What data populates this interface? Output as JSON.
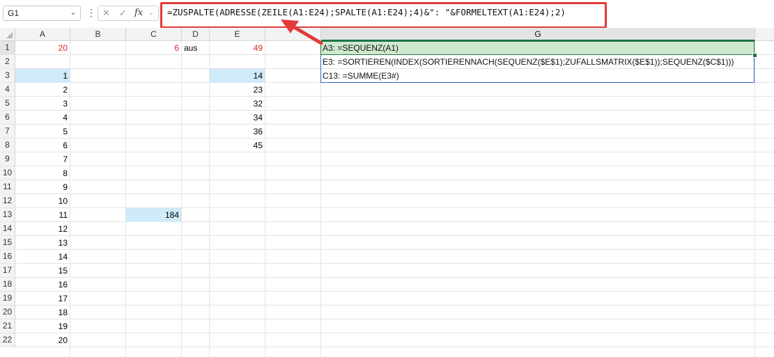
{
  "formula_bar": {
    "name_box": "G1",
    "formula": "=ZUSPALTE(ADRESSE(ZEILE(A1:E24);SPALTE(A1:E24);4)&\": \"&FORMELTEXT(A1:E24);2)",
    "fx_label": "fx"
  },
  "columns": [
    "A",
    "B",
    "C",
    "D",
    "E",
    "G"
  ],
  "rows": [
    "1",
    "2",
    "3",
    "4",
    "5",
    "6",
    "7",
    "8",
    "9",
    "10",
    "11",
    "12",
    "13",
    "14",
    "15",
    "16",
    "17",
    "18",
    "19",
    "20",
    "21",
    "22"
  ],
  "cells": {
    "A1": "20",
    "C1": "6",
    "D1": "aus",
    "E1": "49",
    "A3": "1",
    "A4": "2",
    "A5": "3",
    "A6": "4",
    "A7": "5",
    "A8": "6",
    "A9": "7",
    "A10": "8",
    "A11": "9",
    "A12": "10",
    "A13": "11",
    "A14": "12",
    "A15": "13",
    "A16": "14",
    "A17": "15",
    "A18": "16",
    "A19": "17",
    "A20": "18",
    "A21": "19",
    "A22": "20",
    "E3": "14",
    "E4": "23",
    "E5": "32",
    "E6": "34",
    "E7": "36",
    "E8": "45",
    "C13": "184",
    "G1": "A3: =SEQUENZ(A1)",
    "G2": "E3: =SORTIEREN(INDEX(SORTIERENNACH(SEQUENZ($E$1);ZUFALLSMATRIX($E$1));SEQUENZ($C$1)))",
    "G3": "C13: =SUMME(E3#)"
  },
  "colors": {
    "accent_green": "#217346",
    "highlight_blue": "#cfeaf8",
    "input_red": "#d12b2b",
    "callout_red": "#e23a3a"
  }
}
